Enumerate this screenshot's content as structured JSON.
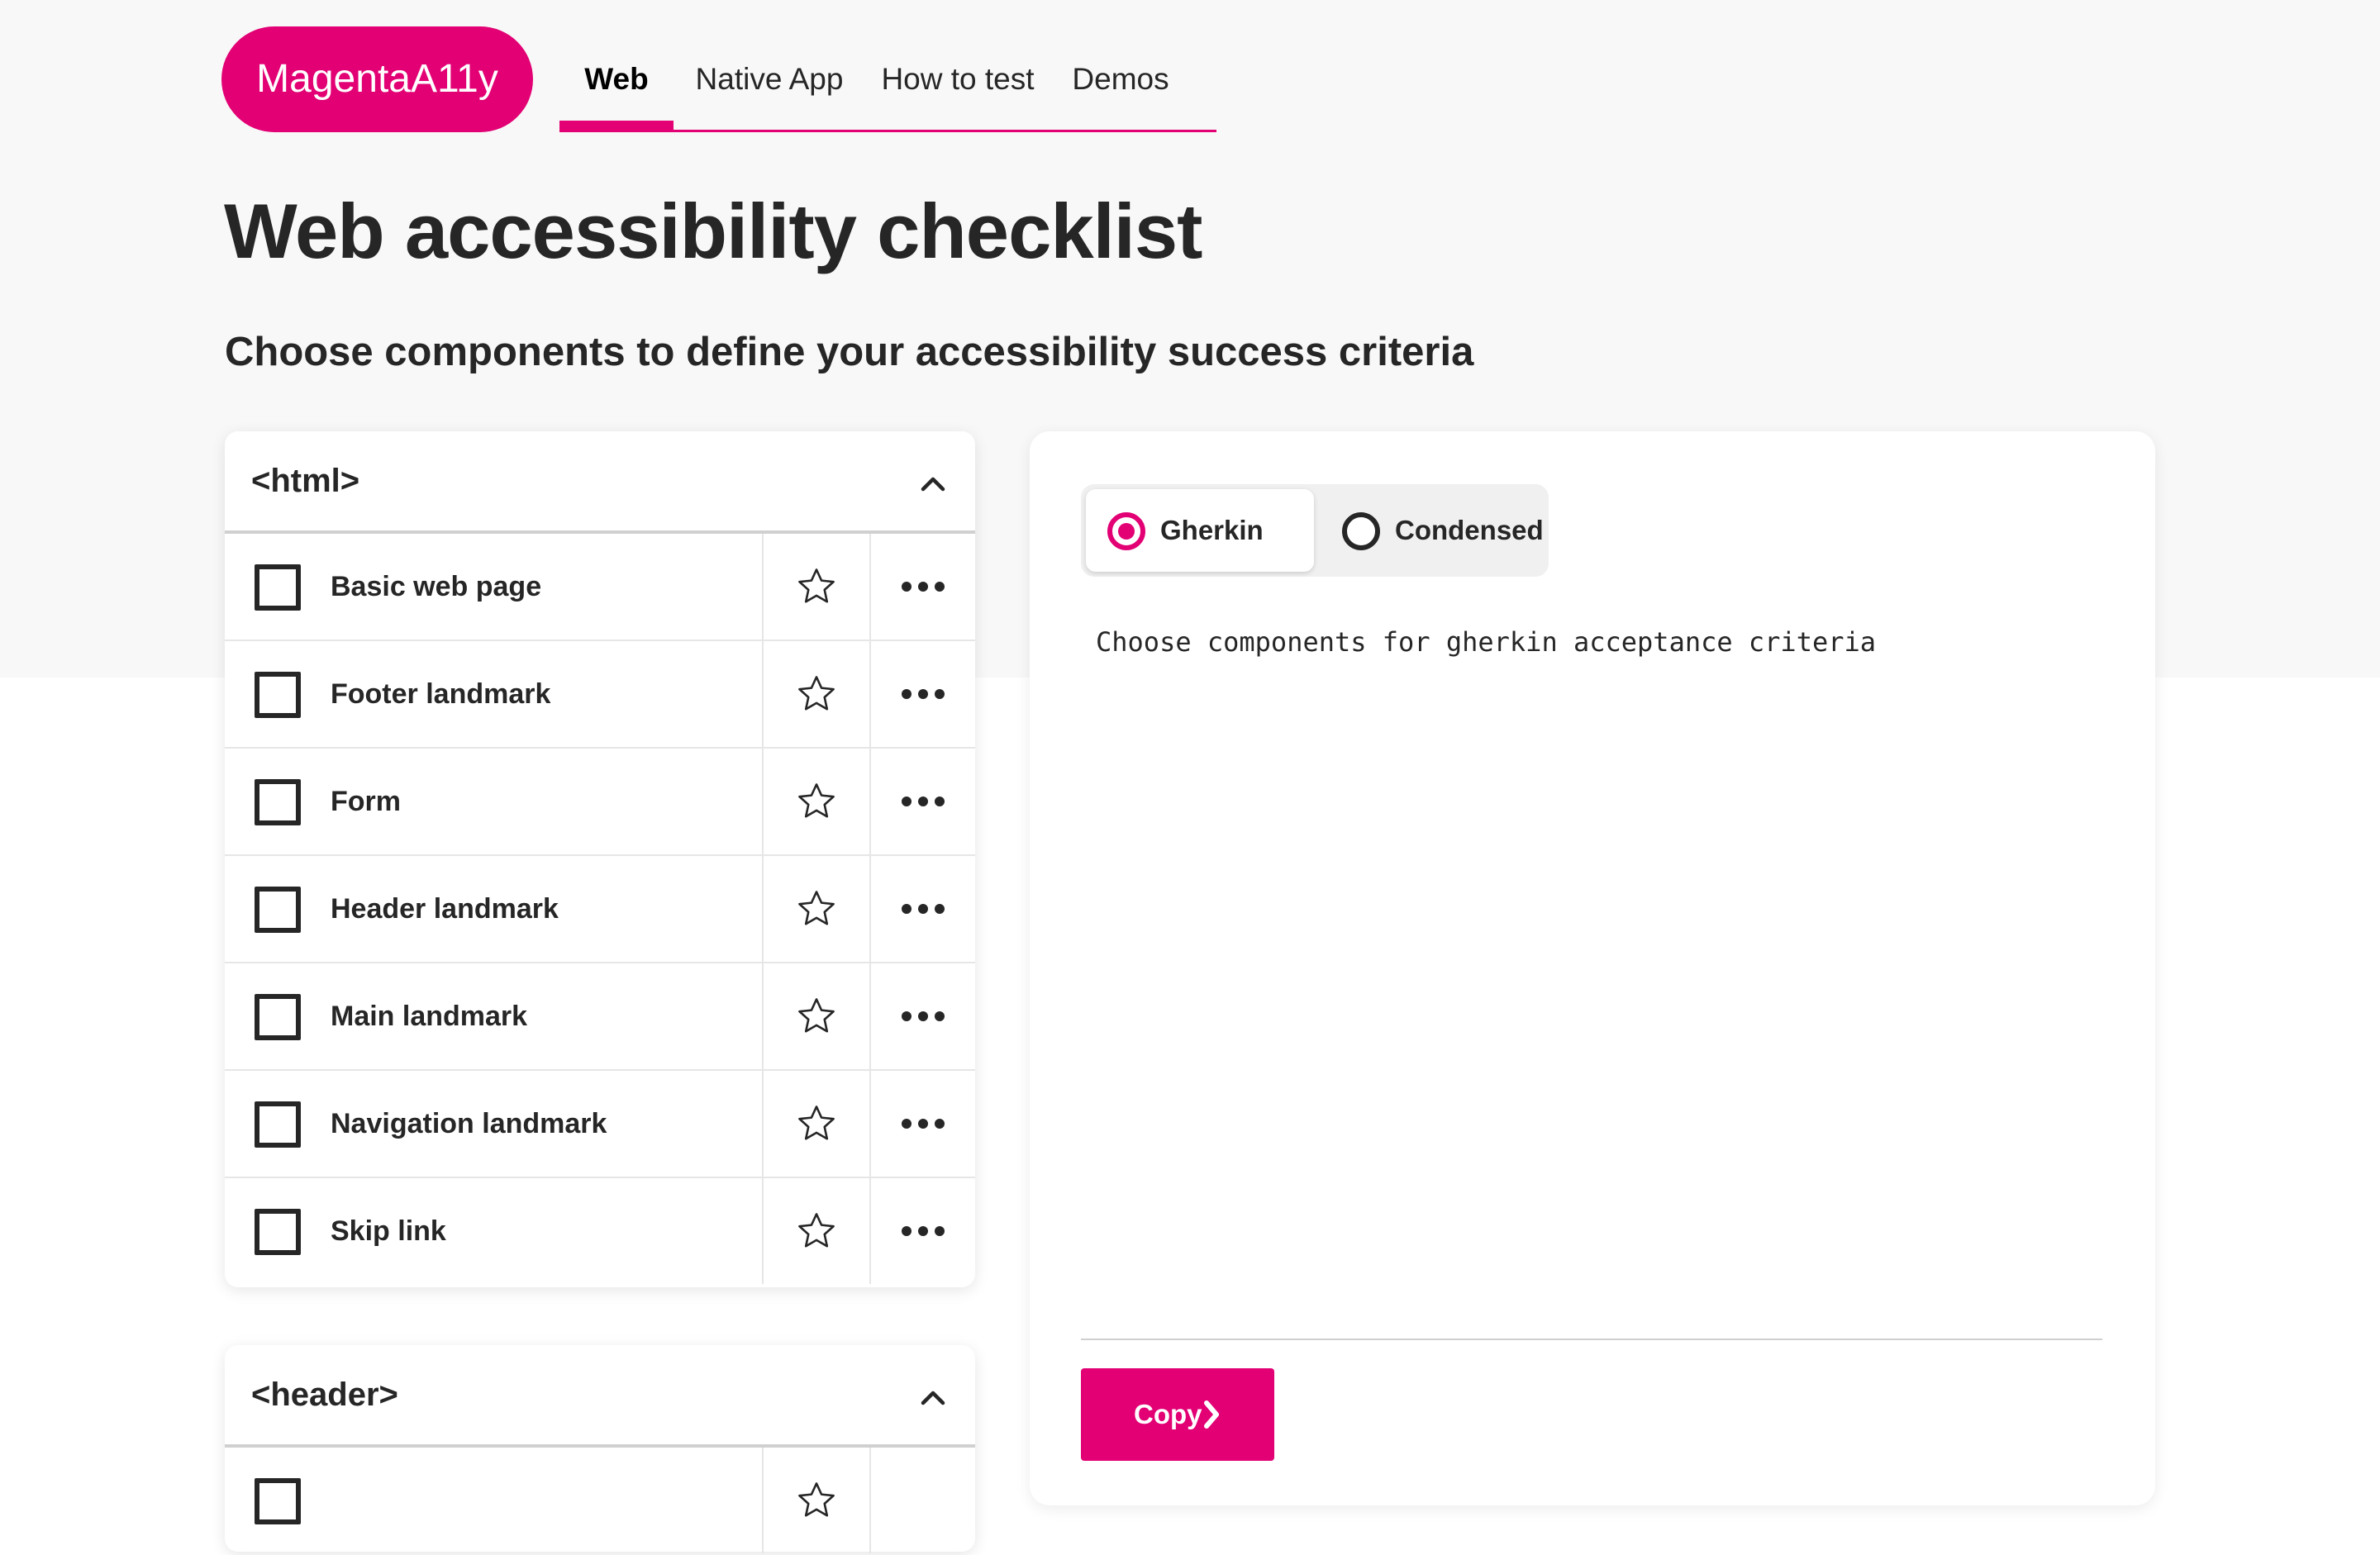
{
  "header": {
    "logo_text": "MagentaA11y",
    "nav": [
      {
        "label": "Web",
        "active": true
      },
      {
        "label": "Native App",
        "active": false
      },
      {
        "label": "How to test",
        "active": false
      },
      {
        "label": "Demos",
        "active": false
      }
    ]
  },
  "main": {
    "title": "Web accessibility checklist",
    "subtitle": "Choose components to define your accessibility success criteria"
  },
  "sections": [
    {
      "title": "<html>",
      "expanded": true,
      "items": [
        {
          "label": "Basic web page",
          "checked": false
        },
        {
          "label": "Footer landmark",
          "checked": false
        },
        {
          "label": "Form",
          "checked": false
        },
        {
          "label": "Header landmark",
          "checked": false
        },
        {
          "label": "Main landmark",
          "checked": false
        },
        {
          "label": "Navigation landmark",
          "checked": false
        },
        {
          "label": "Skip link",
          "checked": false
        }
      ]
    },
    {
      "title": "<header>",
      "expanded": true,
      "items": []
    }
  ],
  "output": {
    "format_options": [
      {
        "label": "Gherkin",
        "selected": true
      },
      {
        "label": "Condensed",
        "selected": false
      }
    ],
    "placeholder": "Choose components for gherkin acceptance criteria",
    "copy_label": "Copy"
  },
  "icons": {
    "favorite": "star-outline-icon",
    "more": "more-horizontal-icon",
    "collapse": "chevron-up-icon",
    "copy": "chevron-right-icon"
  },
  "colors": {
    "brand": "#e20074",
    "text": "#262626",
    "page_background": "#f8f8f8",
    "card_background": "#ffffff"
  }
}
